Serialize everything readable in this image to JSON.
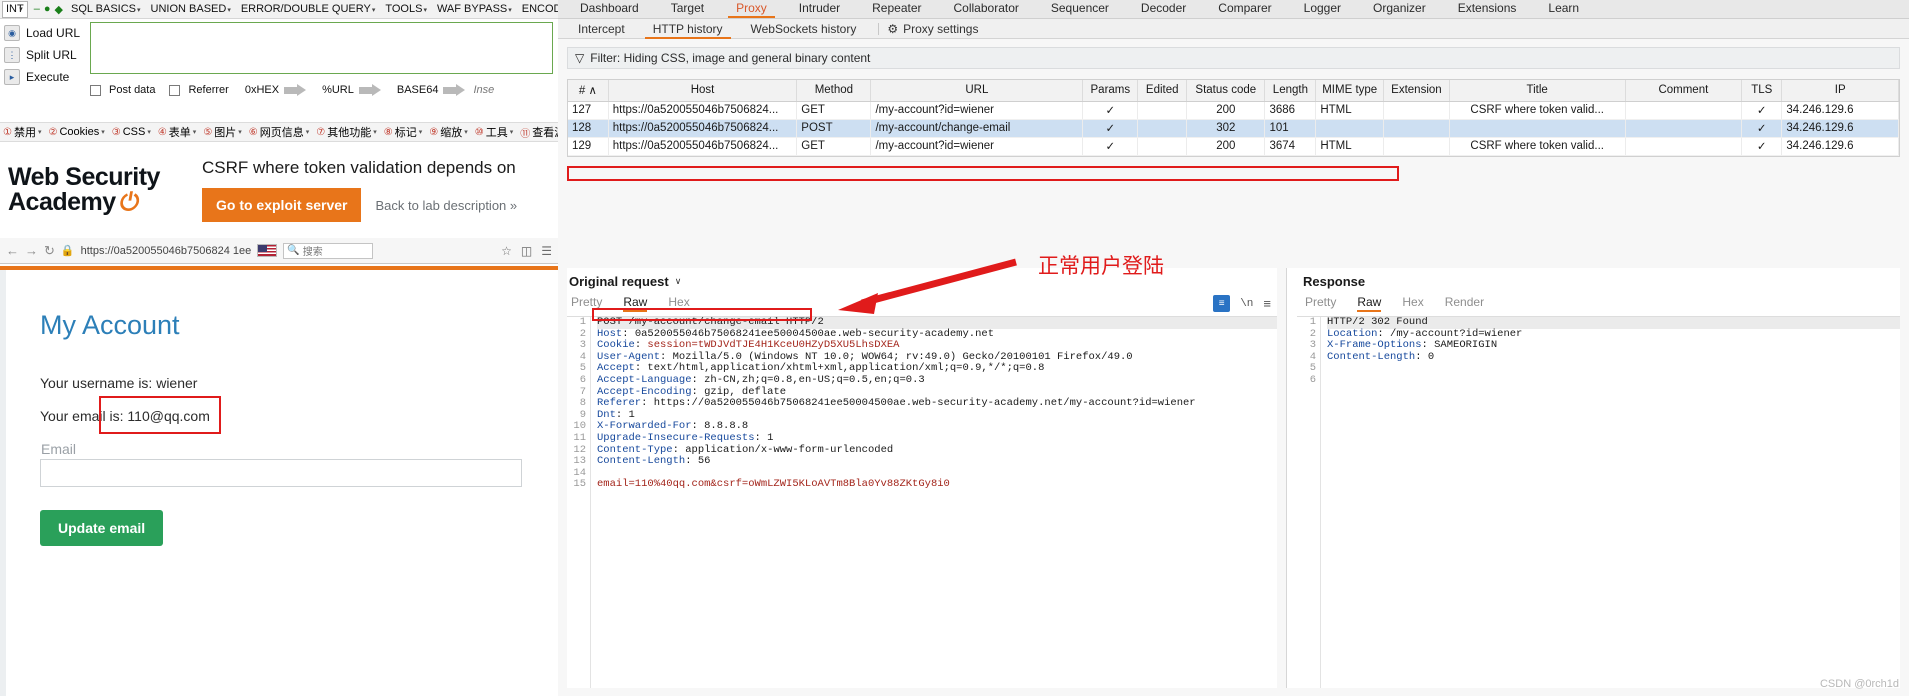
{
  "hackbar": {
    "mode": "INT",
    "menus": [
      {
        "label": "SQL BASICS",
        "caret": "▾"
      },
      {
        "label": "UNION BASED",
        "caret": "▾"
      },
      {
        "label": "ERROR/DOUBLE QUERY",
        "caret": "▾"
      },
      {
        "label": "TOOLS",
        "caret": "▾"
      },
      {
        "label": "WAF BYPASS",
        "caret": "▾"
      },
      {
        "label": "ENCODING",
        "caret": "▾"
      }
    ],
    "buttons": [
      {
        "label": "Load URL",
        "icon": "globe-icon"
      },
      {
        "label": "Split URL",
        "icon": "split-icon"
      },
      {
        "label": "Execute",
        "icon": "play-icon"
      }
    ],
    "options": [
      {
        "label": "Post data",
        "type": "checkbox"
      },
      {
        "label": "Referrer",
        "type": "checkbox"
      },
      {
        "label": "0xHEX",
        "type": "arrow"
      },
      {
        "label": "%URL",
        "type": "arrow"
      },
      {
        "label": "BASE64",
        "type": "arrow"
      }
    ],
    "insert_hint": "Inse",
    "request_text": ""
  },
  "cntoolbar": {
    "items": [
      {
        "label": "禁用",
        "caret": "▾"
      },
      {
        "label": "Cookies",
        "caret": "▾"
      },
      {
        "label": "CSS",
        "caret": "▾"
      },
      {
        "label": "表单",
        "caret": "▾"
      },
      {
        "label": "图片",
        "caret": "▾"
      },
      {
        "label": "网页信息",
        "caret": "▾"
      },
      {
        "label": "其他功能",
        "caret": "▾"
      },
      {
        "label": "标记",
        "caret": "▾"
      },
      {
        "label": "缩放",
        "caret": "▾"
      },
      {
        "label": "工具",
        "caret": "▾"
      },
      {
        "label": "查看源",
        "caret": "▾"
      }
    ]
  },
  "urlbar": {
    "url": "https://0a520055046b7506824 1ee",
    "search_placeholder": "搜索",
    "nav_back": "←",
    "nav_fwd": "→",
    "reload": "↻"
  },
  "academy": {
    "logo_line1": "Web Security",
    "logo_line2": "Academy",
    "bolt": "⚡",
    "lab_title": "CSRF where token validation depends on",
    "exploit_button": "Go to exploit server",
    "back_link": "Back to lab description",
    "back_chevrons": "»"
  },
  "account": {
    "heading": "My Account",
    "username_line": "Your username is: wiener",
    "email_line_prefix": "Your email is:",
    "email_value": "110@qq.com",
    "field_label": "Email",
    "field_value": "",
    "submit_button": "Update email"
  },
  "burp": {
    "main_tabs": [
      {
        "label": "Dashboard",
        "active": false
      },
      {
        "label": "Target",
        "active": false
      },
      {
        "label": "Proxy",
        "active": true
      },
      {
        "label": "Intruder",
        "active": false
      },
      {
        "label": "Repeater",
        "active": false
      },
      {
        "label": "Collaborator",
        "active": false
      },
      {
        "label": "Sequencer",
        "active": false
      },
      {
        "label": "Decoder",
        "active": false
      },
      {
        "label": "Comparer",
        "active": false
      },
      {
        "label": "Logger",
        "active": false
      },
      {
        "label": "Organizer",
        "active": false
      },
      {
        "label": "Extensions",
        "active": false
      },
      {
        "label": "Learn",
        "active": false
      }
    ],
    "sub_tabs": [
      {
        "label": "Intercept",
        "active": false
      },
      {
        "label": "HTTP history",
        "active": true
      },
      {
        "label": "WebSockets history",
        "active": false
      }
    ],
    "proxy_settings": "Proxy settings",
    "filter_text": "Filter: Hiding CSS, image and general binary content",
    "filter_icon": "funnel-icon",
    "columns": [
      "#",
      "Host",
      "Method",
      "URL",
      "Params",
      "Edited",
      "Status code",
      "Length",
      "MIME type",
      "Extension",
      "Title",
      "Comment",
      "TLS",
      "IP"
    ],
    "sort_indicator": "∧",
    "rows": [
      {
        "num": "127",
        "host": "https://0a520055046b7506824...",
        "method": "GET",
        "url": "/my-account?id=wiener",
        "params": "✓",
        "edited": "",
        "status": "200",
        "length": "3686",
        "mime": "HTML",
        "extension": "",
        "title": "CSRF where token valid...",
        "comment": "",
        "tls": "✓",
        "ip": "34.246.129.6",
        "selected": false,
        "highlighted": false
      },
      {
        "num": "128",
        "host": "https://0a520055046b7506824...",
        "method": "POST",
        "url": "/my-account/change-email",
        "params": "✓",
        "edited": "",
        "status": "302",
        "length": "101",
        "mime": "",
        "extension": "",
        "title": "",
        "comment": "",
        "tls": "✓",
        "ip": "34.246.129.6",
        "selected": true,
        "highlighted": true
      },
      {
        "num": "129",
        "host": "https://0a520055046b7506824...",
        "method": "GET",
        "url": "/my-account?id=wiener",
        "params": "✓",
        "edited": "",
        "status": "200",
        "length": "3674",
        "mime": "HTML",
        "extension": "",
        "title": "CSRF where token valid...",
        "comment": "",
        "tls": "✓",
        "ip": "34.246.129.6",
        "selected": false,
        "highlighted": false
      }
    ],
    "request_pane": {
      "title": "Original request",
      "caret": "∨",
      "view_tabs": [
        {
          "label": "Pretty",
          "active": false
        },
        {
          "label": "Raw",
          "active": true
        },
        {
          "label": "Hex",
          "active": false
        }
      ],
      "lines": [
        {
          "n": 1,
          "text": "POST /my-account/change-email HTTP/2",
          "kind": "start"
        },
        {
          "n": 2,
          "key": "Host",
          "val": " 0a520055046b75068241ee50004500ae.web-security-academy.net"
        },
        {
          "n": 3,
          "key": "Cookie",
          "val": " session=tWDJVdTJE4H1KceU0HZyD5XU5LhsDXEA",
          "valred": true
        },
        {
          "n": 4,
          "key": "User-Agent",
          "val": " Mozilla/5.0 (Windows NT 10.0; WOW64; rv:49.0) Gecko/20100101 Firefox/49.0"
        },
        {
          "n": 5,
          "key": "Accept",
          "val": " text/html,application/xhtml+xml,application/xml;q=0.9,*/*;q=0.8"
        },
        {
          "n": 6,
          "key": "Accept-Language",
          "val": " zh-CN,zh;q=0.8,en-US;q=0.5,en;q=0.3"
        },
        {
          "n": 7,
          "key": "Accept-Encoding",
          "val": " gzip, deflate"
        },
        {
          "n": 8,
          "key": "Referer",
          "val": " https://0a520055046b75068241ee50004500ae.web-security-academy.net/my-account?id=wiener"
        },
        {
          "n": 9,
          "key": "Dnt",
          "val": " 1"
        },
        {
          "n": 10,
          "key": "X-Forwarded-For",
          "val": " 8.8.8.8"
        },
        {
          "n": 11,
          "key": "Upgrade-Insecure-Requests",
          "val": " 1"
        },
        {
          "n": 12,
          "key": "Content-Type",
          "val": " application/x-www-form-urlencoded"
        },
        {
          "n": 13,
          "key": "Content-Length",
          "val": " 56"
        },
        {
          "n": 14,
          "text": "",
          "kind": "blank"
        },
        {
          "n": 15,
          "text": "email=110%40qq.com&csrf=oWmLZWI5KLoAVTm8Bla0Yv88ZKtGy8i0",
          "kind": "body"
        }
      ],
      "tools": {
        "pretty_btn": "format-icon",
        "newline_btn": "\\n",
        "menu_btn": "≡"
      }
    },
    "response_pane": {
      "title": "Response",
      "view_tabs": [
        {
          "label": "Pretty",
          "active": false
        },
        {
          "label": "Raw",
          "active": true
        },
        {
          "label": "Hex",
          "active": false
        },
        {
          "label": "Render",
          "active": false
        }
      ],
      "lines": [
        {
          "n": 1,
          "text": "HTTP/2 302 Found",
          "kind": "start"
        },
        {
          "n": 2,
          "key": "Location",
          "val": " /my-account?id=wiener"
        },
        {
          "n": 3,
          "key": "X-Frame-Options",
          "val": " SAMEORIGIN"
        },
        {
          "n": 4,
          "key": "Content-Length",
          "val": " 0"
        },
        {
          "n": 5,
          "text": "",
          "kind": "blank"
        },
        {
          "n": 6,
          "text": "",
          "kind": "blank"
        }
      ]
    }
  },
  "annotation": {
    "caption": "正常用户登陆",
    "color": "#e01b1b"
  },
  "watermark": "CSDN @0rch1d"
}
